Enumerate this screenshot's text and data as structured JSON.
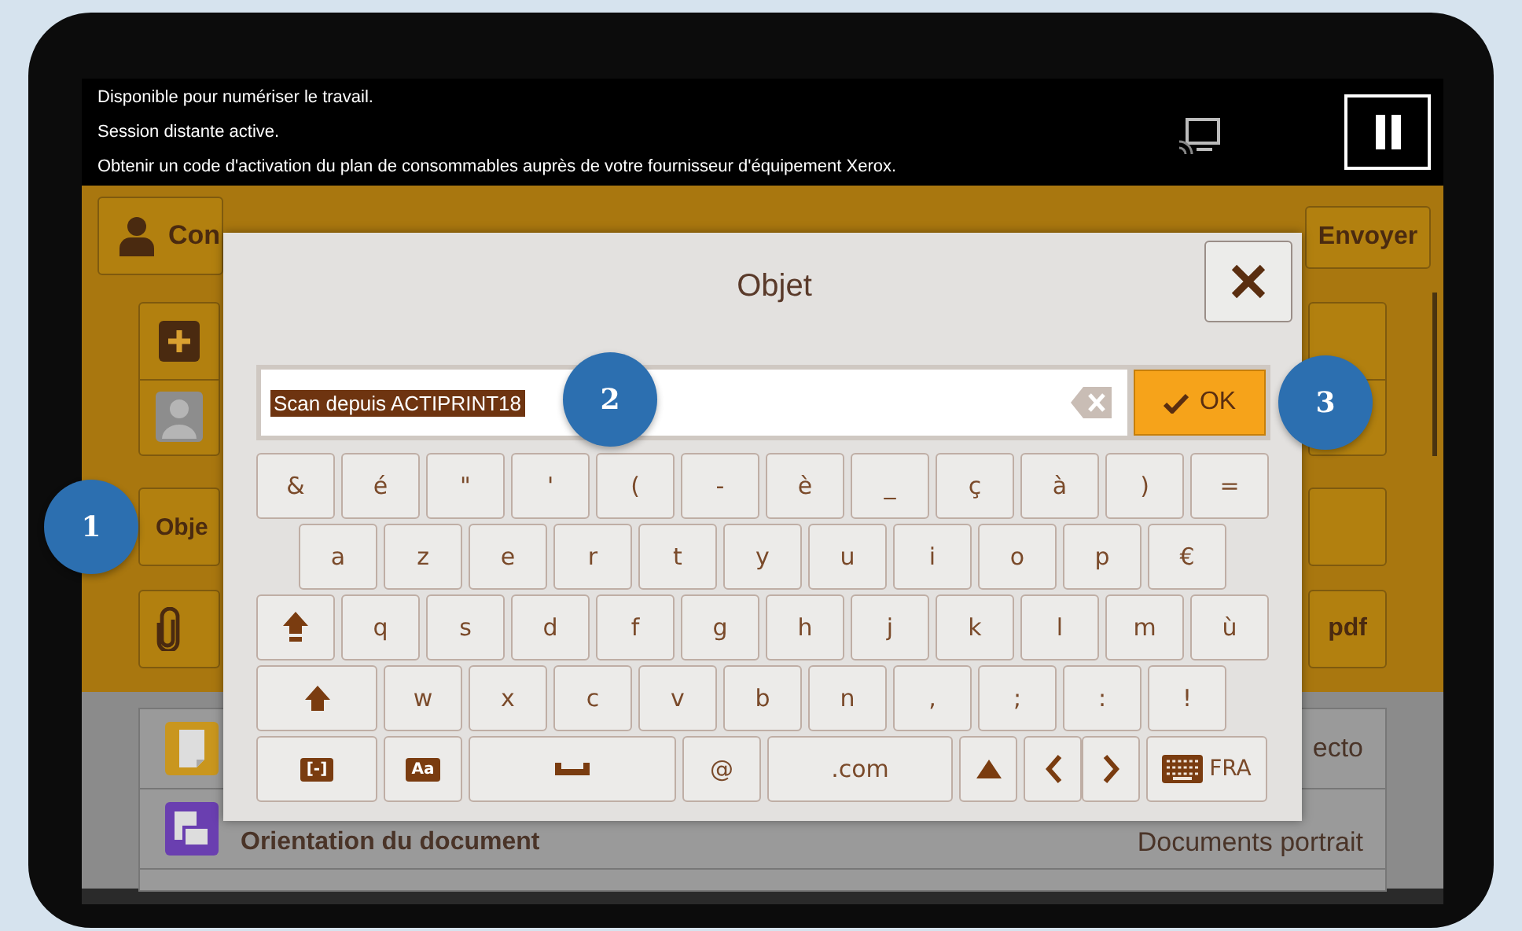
{
  "status_messages": [
    "Disponible pour numériser le travail.",
    "Session distante active.",
    "Obtenir un code d'activation du plan de consommables auprès de votre fournisseur d'équipement Xerox."
  ],
  "background": {
    "contact_button": "Con",
    "send_button": "Envoyer",
    "subject_button": "Obje",
    "format_button": "pdf",
    "settings_rows": [
      {
        "kind": "page",
        "value": "ecto"
      },
      {
        "kind": "orientation",
        "label": "Orientation du document",
        "value": "Documents portrait"
      }
    ]
  },
  "dialog": {
    "title": "Objet",
    "value": "Scan depuis ACTIPRINT18",
    "value_selected": true,
    "ok": "OK",
    "language": "FRA",
    "keyboard_rows": [
      [
        {
          "kind": "char",
          "label": "&"
        },
        {
          "kind": "char",
          "label": "é"
        },
        {
          "kind": "char",
          "label": "\""
        },
        {
          "kind": "char",
          "label": "'"
        },
        {
          "kind": "char",
          "label": "("
        },
        {
          "kind": "char",
          "label": "-"
        },
        {
          "kind": "char",
          "label": "è"
        },
        {
          "kind": "char",
          "label": "_"
        },
        {
          "kind": "char",
          "label": "ç"
        },
        {
          "kind": "char",
          "label": "à"
        },
        {
          "kind": "char",
          "label": ")"
        },
        {
          "kind": "char",
          "label": "="
        }
      ],
      [
        {
          "kind": "char",
          "label": "a"
        },
        {
          "kind": "char",
          "label": "z"
        },
        {
          "kind": "char",
          "label": "e"
        },
        {
          "kind": "char",
          "label": "r"
        },
        {
          "kind": "char",
          "label": "t"
        },
        {
          "kind": "char",
          "label": "y"
        },
        {
          "kind": "char",
          "label": "u"
        },
        {
          "kind": "char",
          "label": "i"
        },
        {
          "kind": "char",
          "label": "o"
        },
        {
          "kind": "char",
          "label": "p"
        },
        {
          "kind": "char",
          "label": "€"
        }
      ],
      [
        {
          "kind": "shiftlock"
        },
        {
          "kind": "char",
          "label": "q"
        },
        {
          "kind": "char",
          "label": "s"
        },
        {
          "kind": "char",
          "label": "d"
        },
        {
          "kind": "char",
          "label": "f"
        },
        {
          "kind": "char",
          "label": "g"
        },
        {
          "kind": "char",
          "label": "h"
        },
        {
          "kind": "char",
          "label": "j"
        },
        {
          "kind": "char",
          "label": "k"
        },
        {
          "kind": "char",
          "label": "l"
        },
        {
          "kind": "char",
          "label": "m"
        },
        {
          "kind": "char",
          "label": "ù"
        }
      ],
      [
        {
          "kind": "shift"
        },
        {
          "kind": "char",
          "label": "w"
        },
        {
          "kind": "char",
          "label": "x"
        },
        {
          "kind": "char",
          "label": "c"
        },
        {
          "kind": "char",
          "label": "v"
        },
        {
          "kind": "char",
          "label": "b"
        },
        {
          "kind": "char",
          "label": "n"
        },
        {
          "kind": "char",
          "label": ","
        },
        {
          "kind": "char",
          "label": ";"
        },
        {
          "kind": "char",
          "label": ":"
        },
        {
          "kind": "char",
          "label": "!"
        }
      ],
      [
        {
          "kind": "symbols",
          "label": "[-]"
        },
        {
          "kind": "accents",
          "label": "Aa"
        },
        {
          "kind": "space"
        },
        {
          "kind": "char",
          "label": "@"
        },
        {
          "kind": "wide",
          "label": ".com"
        },
        {
          "kind": "up"
        },
        {
          "kind": "left"
        },
        {
          "kind": "right"
        },
        {
          "kind": "lang"
        }
      ]
    ]
  },
  "callouts": [
    "1",
    "2",
    "3"
  ]
}
